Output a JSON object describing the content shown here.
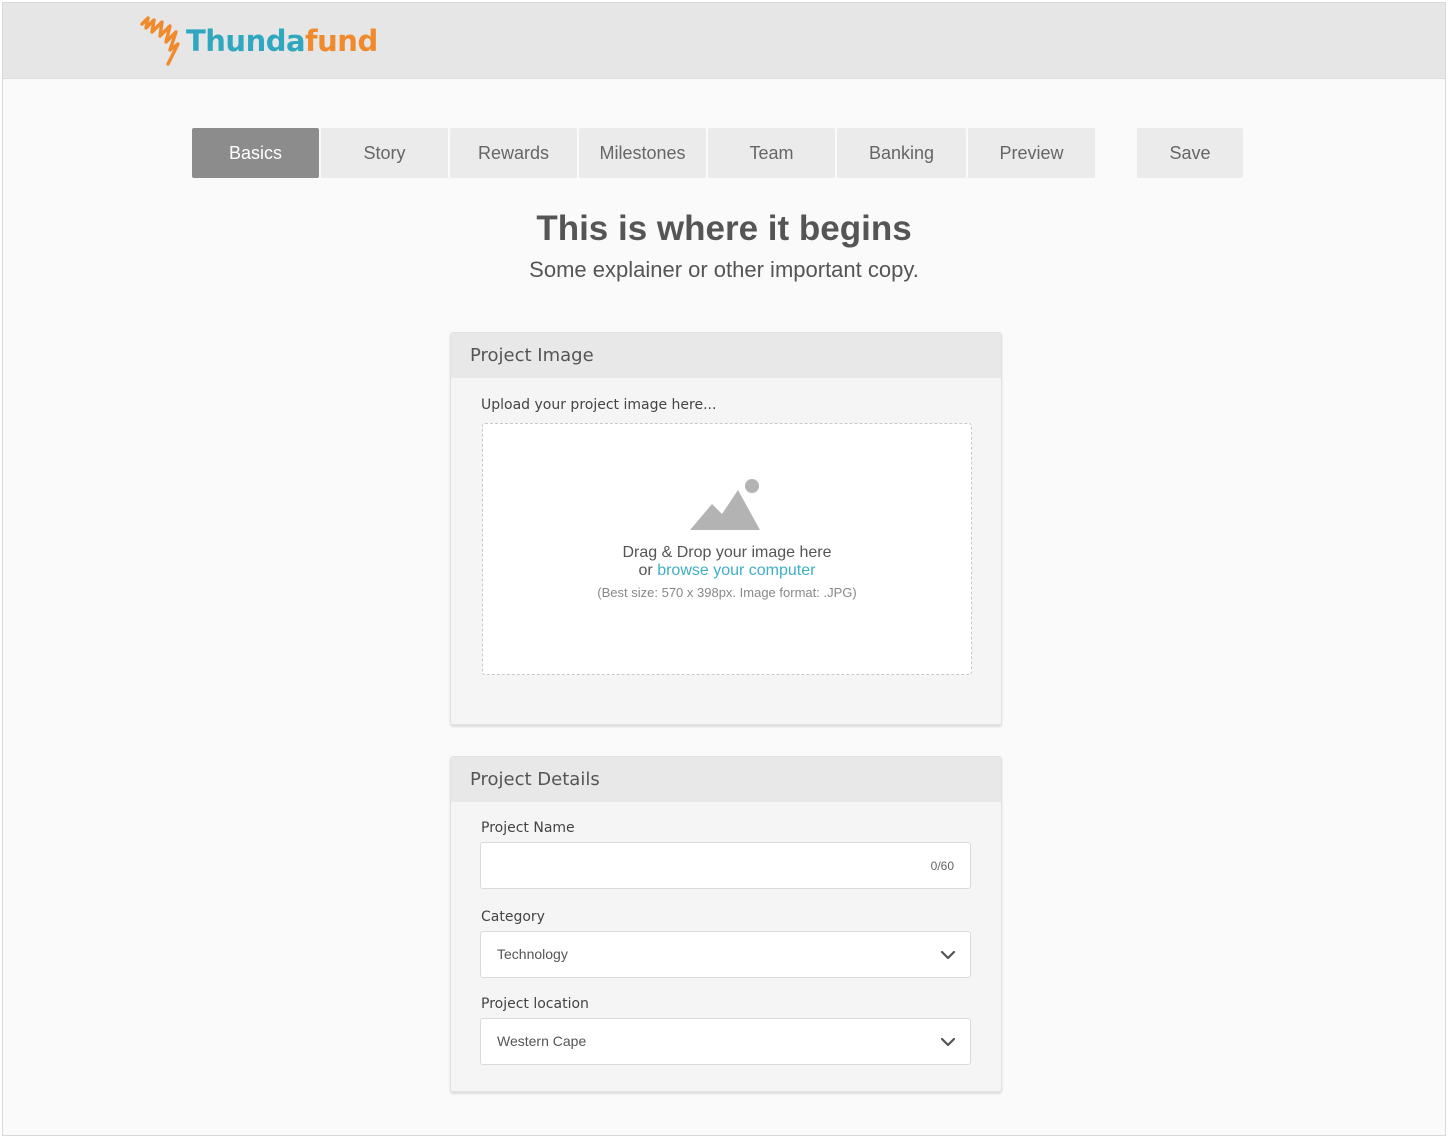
{
  "brand": {
    "name_part1": "Thunda",
    "name_part2": "fund"
  },
  "tabs": [
    {
      "label": "Basics",
      "active": true
    },
    {
      "label": "Story",
      "active": false
    },
    {
      "label": "Rewards",
      "active": false
    },
    {
      "label": "Milestones",
      "active": false
    },
    {
      "label": "Team",
      "active": false
    },
    {
      "label": "Banking",
      "active": false
    },
    {
      "label": "Preview",
      "active": false
    }
  ],
  "save_label": "Save",
  "intro": {
    "title": "This is where it begins",
    "subtitle": "Some explainer or other important copy."
  },
  "project_image": {
    "title": "Project Image",
    "upload_label": "Upload your project image here...",
    "drop_text": "Drag & Drop your image here",
    "or_text": "or ",
    "browse_link": "browse your computer",
    "hint": "(Best size: 570 x 398px. Image format: .JPG)"
  },
  "project_details": {
    "title": "Project Details",
    "name_label": "Project Name",
    "name_value": "",
    "name_counter": "0/60",
    "category_label": "Category",
    "category_value": "Technology",
    "location_label": "Project location",
    "location_value": "Western Cape"
  },
  "colors": {
    "brand_teal": "#2fa8bf",
    "brand_orange": "#f08a2c",
    "active_tab": "#8c8c8c",
    "link": "#3fb0c4"
  },
  "icons": {
    "logo": "lightning-scribble-icon",
    "upload": "image-placeholder-icon",
    "dropdown": "chevron-down-icon"
  }
}
